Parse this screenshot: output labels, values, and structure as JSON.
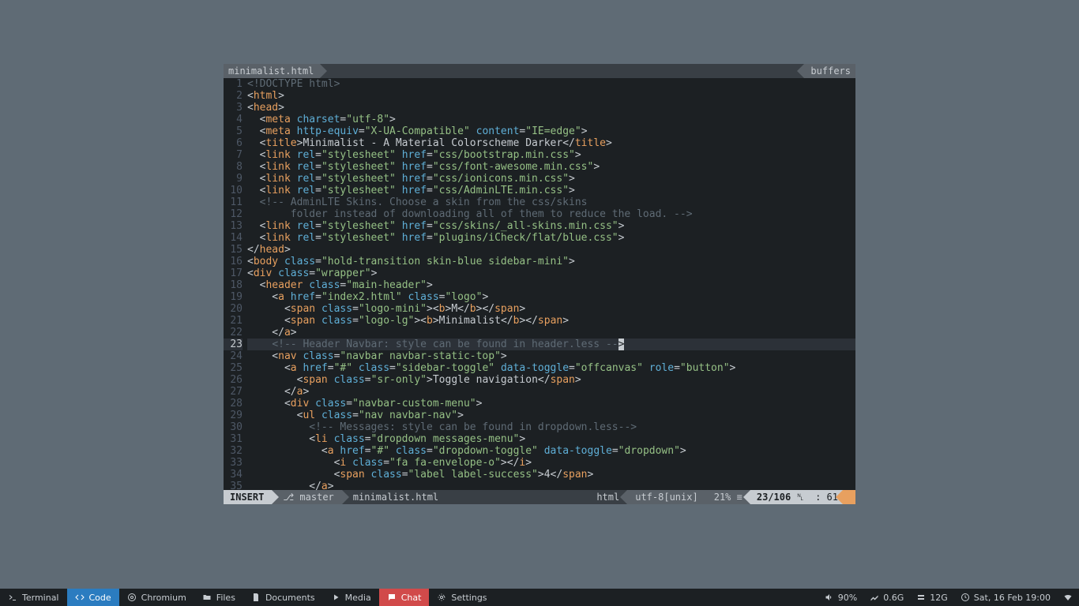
{
  "editor": {
    "tab_filename": "minimalist.html",
    "buffers_label": "buffers",
    "current_line_index": 22,
    "gutter": [
      "1",
      "2",
      "3",
      "4",
      "5",
      "6",
      "7",
      "8",
      "9",
      "10",
      "11",
      "12",
      "13",
      "14",
      "15",
      "16",
      "17",
      "18",
      "19",
      "20",
      "21",
      "22",
      "23",
      "24",
      "25",
      "26",
      "27",
      "28",
      "29",
      "30",
      "31",
      "32",
      "33",
      "34",
      "35"
    ],
    "status": {
      "mode": "INSERT",
      "branch_icon": "⎇",
      "branch": "master",
      "filename": "minimalist.html",
      "filetype": "html",
      "encoding": "utf-8[unix]",
      "percent": "21%",
      "line_icon": "≡",
      "position": "23/106",
      "ln_icon": "␤",
      "colsep": ":",
      "col": "61"
    }
  },
  "code_text": {
    "l1": "<!DOCTYPE html>",
    "l6_title": "Minimalist - A Material Colorscheme Darker",
    "l11_comment": "<!-- AdminLTE Skins. Choose a skin from the css/skins",
    "l12_comment": "     folder instead of downloading all of them to reduce the load. -->",
    "l20_text": "M",
    "l21_text": "Minimalist",
    "l23_comment": "<!-- Header Navbar: style can be found in header.less --",
    "l26_text": "Toggle navigation",
    "l30_comment": "<!-- Messages: style can be found in dropdown.less-->",
    "l34_text": "4",
    "strings": {
      "utf8": "\"utf-8\"",
      "xua": "\"X-UA-Compatible\"",
      "ieedge": "\"IE=edge\"",
      "stylesheet": "\"stylesheet\"",
      "bootstrap": "\"css/bootstrap.min.css\"",
      "fontawesome": "\"css/font-awesome.min.css\"",
      "ionicons": "\"css/ionicons.min.css\"",
      "adminlte": "\"css/AdminLTE.min.css\"",
      "allskins": "\"css/skins/_all-skins.min.css\"",
      "icheck": "\"plugins/iCheck/flat/blue.css\"",
      "bodyclass": "\"hold-transition skin-blue sidebar-mini\"",
      "wrapper": "\"wrapper\"",
      "mainheader": "\"main-header\"",
      "index2": "\"index2.html\"",
      "logo": "\"logo\"",
      "logomini": "\"logo-mini\"",
      "logolg": "\"logo-lg\"",
      "navbarstatic": "\"navbar navbar-static-top\"",
      "hash": "\"#\"",
      "sidebartoggle": "\"sidebar-toggle\"",
      "offcanvas": "\"offcanvas\"",
      "button": "\"button\"",
      "sronly": "\"sr-only\"",
      "navbarcustom": "\"navbar-custom-menu\"",
      "navnav": "\"nav navbar-nav\"",
      "dropdownmsg": "\"dropdown messages-menu\"",
      "dropdowntoggle": "\"dropdown-toggle\"",
      "dropdown": "\"dropdown\"",
      "faenvelope": "\"fa fa-envelope-o\"",
      "labelsuccess": "\"label label-success\""
    }
  },
  "taskbar": {
    "items": [
      {
        "icon": "terminal",
        "label": "Terminal"
      },
      {
        "icon": "code",
        "label": "Code"
      },
      {
        "icon": "chromium",
        "label": "Chromium"
      },
      {
        "icon": "folder",
        "label": "Files"
      },
      {
        "icon": "document",
        "label": "Documents"
      },
      {
        "icon": "media",
        "label": "Media"
      },
      {
        "icon": "chat",
        "label": "Chat"
      },
      {
        "icon": "settings",
        "label": "Settings"
      }
    ],
    "active_index": 1,
    "red_index": 6,
    "right": {
      "volume": "90%",
      "cpu": "0.6G",
      "disk": "12G",
      "clock": "Sat, 16 Feb 19:00"
    }
  }
}
